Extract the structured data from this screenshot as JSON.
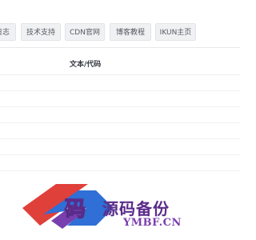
{
  "tabs": [
    {
      "label": "日志"
    },
    {
      "label": "技术支持"
    },
    {
      "label": "CDN官网"
    },
    {
      "label": "博客教程"
    },
    {
      "label": "IKUN主页"
    }
  ],
  "table": {
    "column_header": "文本/代码",
    "rows": [
      "",
      "",
      "",
      "",
      "",
      ""
    ]
  },
  "watermark": {
    "logo_glyph": "码",
    "title": "源码备份",
    "subtitle": "YMBF.CN"
  },
  "colors": {
    "watermark_primary": "#5a2c8a",
    "watermark_red": "#e0403a",
    "watermark_blue": "#2f6fd6"
  }
}
